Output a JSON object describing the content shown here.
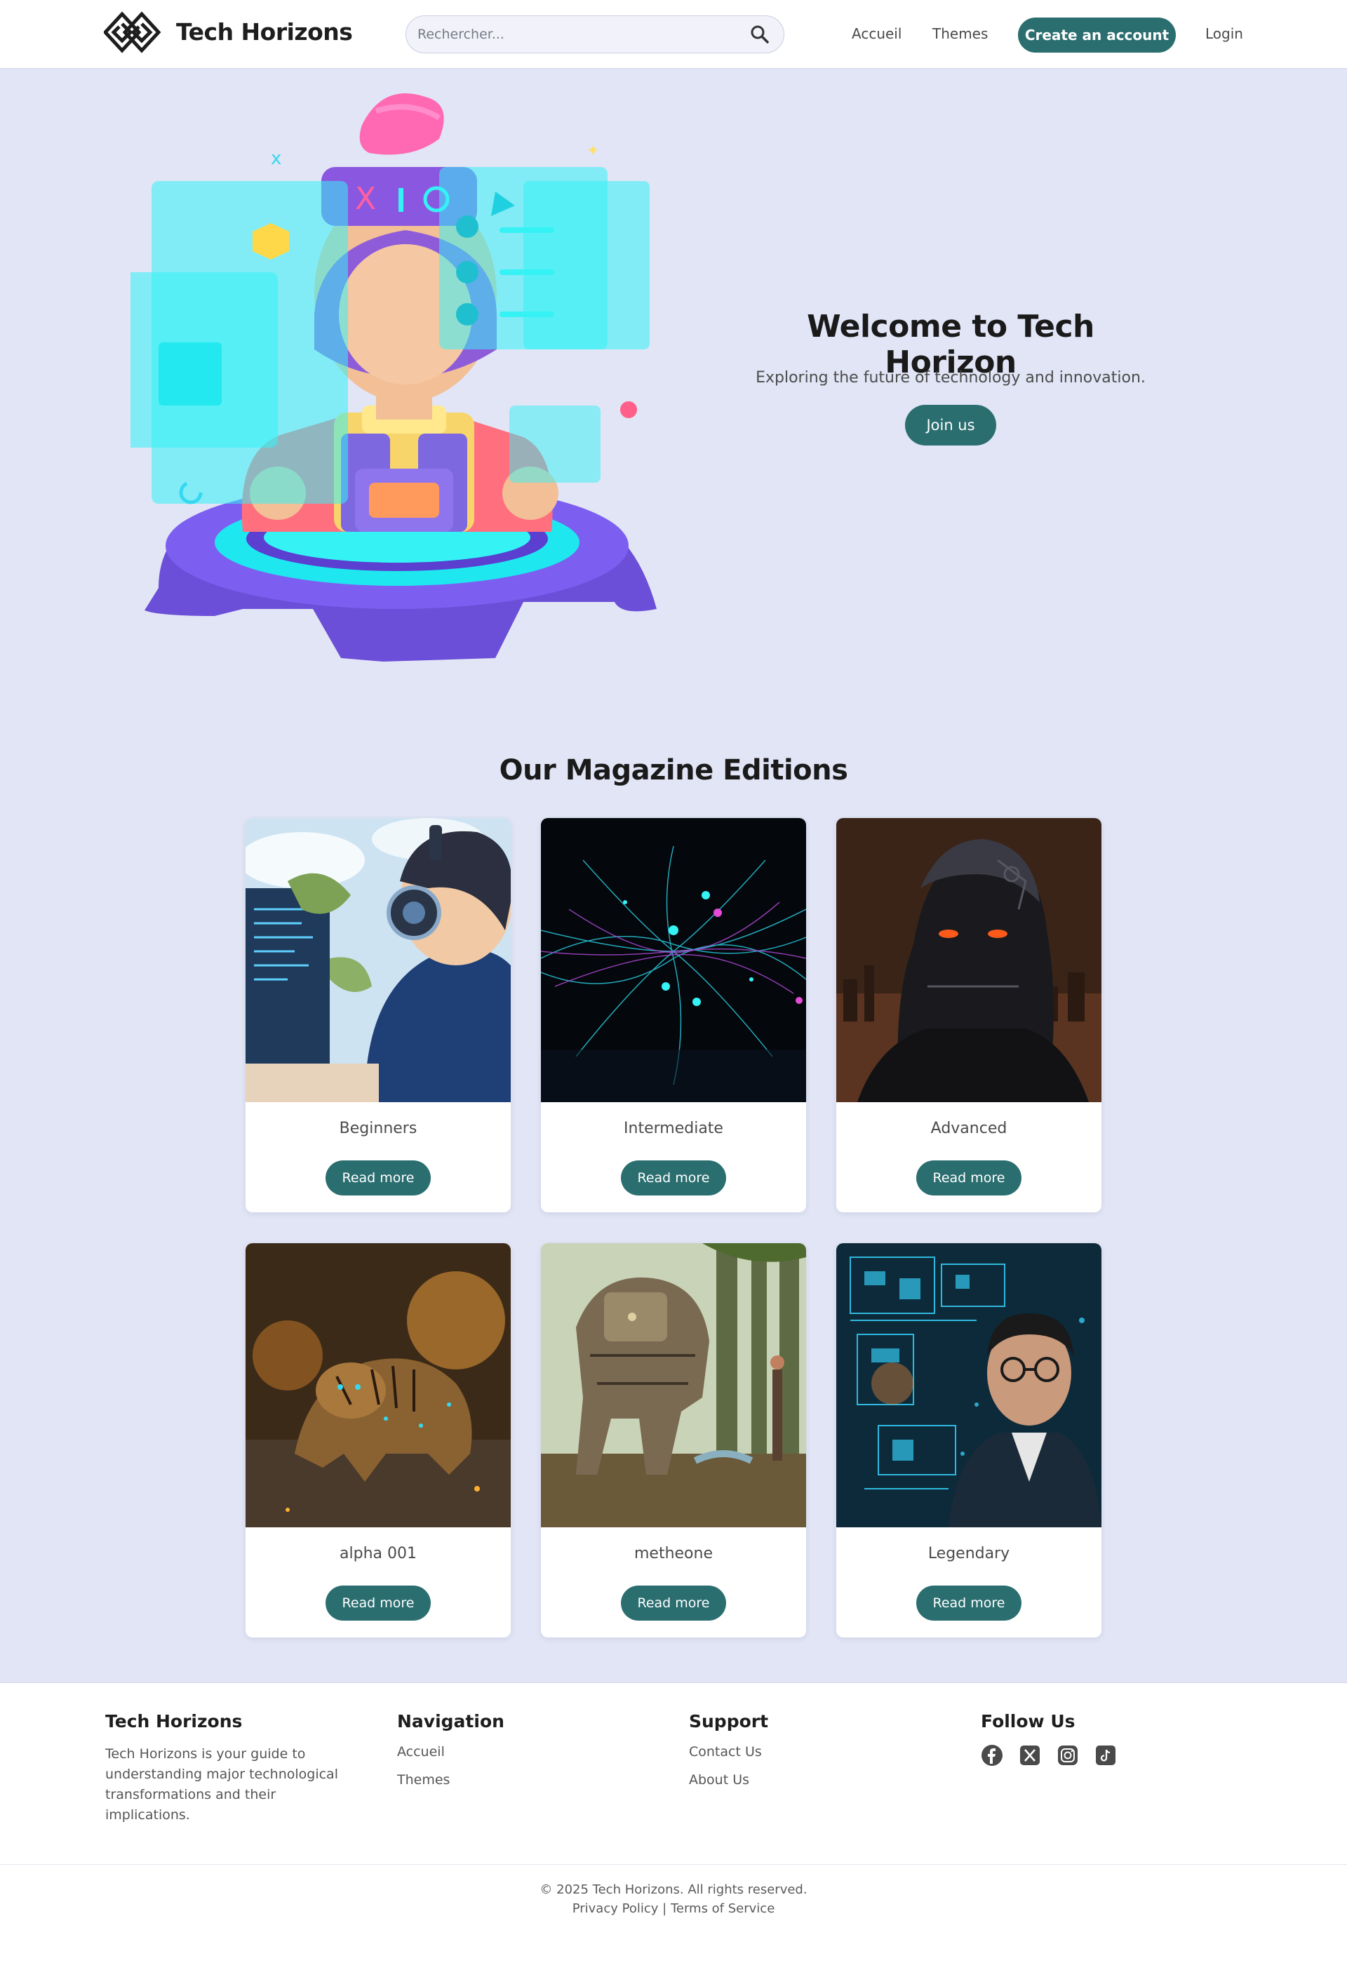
{
  "header": {
    "brand": "Tech Horizons",
    "search_placeholder": "Rechercher...",
    "nav": {
      "home": "Accueil",
      "themes": "Themes",
      "create_account": "Create an account",
      "login": "Login"
    }
  },
  "hero": {
    "title": "Welcome to Tech Horizon",
    "subtitle": "Exploring the future of technology and innovation.",
    "cta": "Join us"
  },
  "magazines": {
    "title": "Our Magazine Editions",
    "read_more": "Read more",
    "items": [
      {
        "title": "Beginners"
      },
      {
        "title": "Intermediate"
      },
      {
        "title": "Advanced"
      },
      {
        "title": "alpha 001"
      },
      {
        "title": "metheone"
      },
      {
        "title": "Legendary"
      }
    ]
  },
  "footer": {
    "about": {
      "title": "Tech Horizons",
      "description": "Tech Horizons is your guide to understanding major technological transformations and their implications."
    },
    "navigation": {
      "title": "Navigation",
      "links": [
        "Accueil",
        "Themes"
      ]
    },
    "support": {
      "title": "Support",
      "links": [
        "Contact Us",
        "About Us"
      ]
    },
    "follow": {
      "title": "Follow Us",
      "icons": [
        "facebook-icon",
        "x-icon",
        "instagram-icon",
        "tiktok-icon"
      ]
    },
    "copyright": "© 2025 Tech Horizons. All rights reserved.",
    "privacy": "Privacy Policy",
    "separator": "|",
    "terms": "Terms of Service"
  },
  "colors": {
    "accent": "#2b6e70",
    "page_background": "#e1e5f5",
    "header_background": "#ffffff"
  }
}
